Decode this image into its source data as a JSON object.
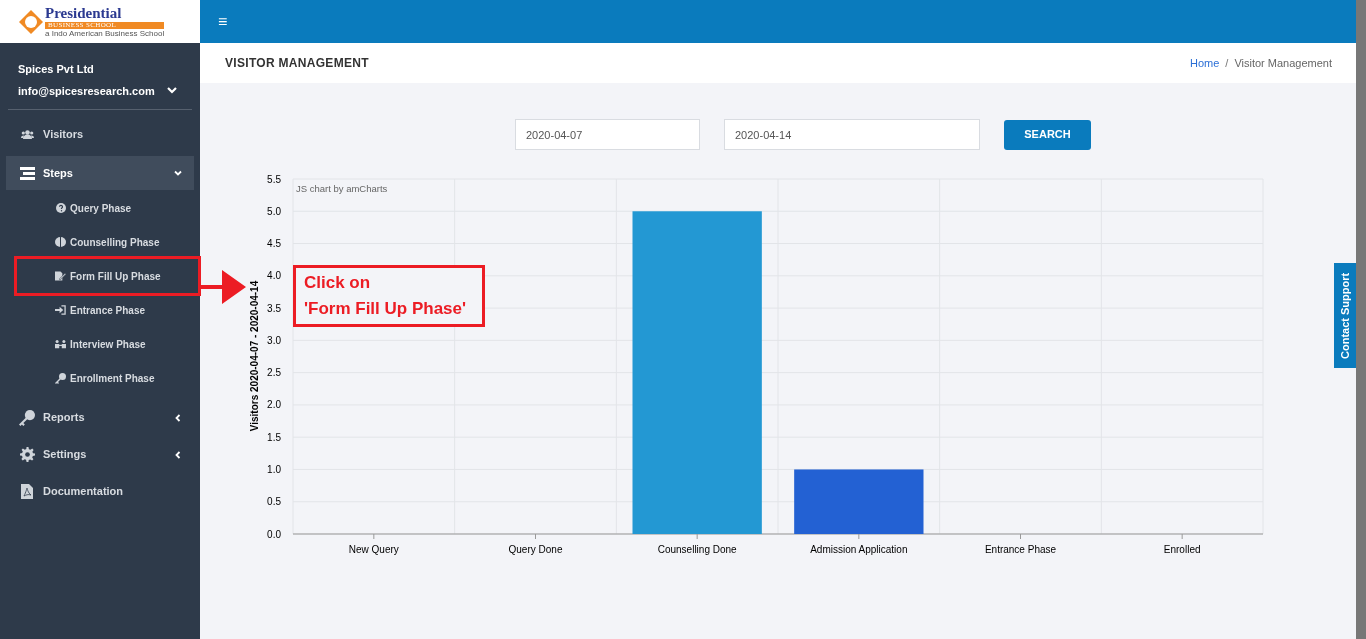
{
  "logo": {
    "name": "Presidential",
    "subtitle": "BUSINESS SCHOOL",
    "tagline": "a Indo American Business School"
  },
  "user": {
    "name": "Spices Pvt Ltd",
    "email": "info@spicesresearch.com"
  },
  "sidebar": {
    "items": [
      {
        "label": "Visitors",
        "selected": false
      },
      {
        "label": "Steps",
        "selected": true,
        "expanded": true,
        "children": [
          {
            "label": "Query Phase",
            "selected": false
          },
          {
            "label": "Counselling Phase",
            "selected": false
          },
          {
            "label": "Form Fill Up Phase",
            "selected": false
          },
          {
            "label": "Entrance Phase",
            "selected": false
          },
          {
            "label": "Interview Phase",
            "selected": false
          },
          {
            "label": "Enrollment Phase",
            "selected": false
          }
        ]
      },
      {
        "label": "Reports",
        "selected": false,
        "expanded": false
      },
      {
        "label": "Settings",
        "selected": false,
        "expanded": false
      },
      {
        "label": "Documentation",
        "selected": false
      }
    ]
  },
  "topbar": {
    "menu_icon": "≡"
  },
  "page": {
    "title": "VISITOR MANAGEMENT",
    "breadcrumb": [
      "Home",
      "Visitor Management"
    ],
    "breadcrumb_separator": "/"
  },
  "filters": {
    "from": "2020-04-07",
    "to": "2020-04-14",
    "button": "SEARCH"
  },
  "chart": {
    "credit": "JS chart by amCharts",
    "chart_data": {
      "type": "bar",
      "ylabel": "Visitors 2020-04-07 - 2020-04-14",
      "categories": [
        "New Query",
        "Query Done",
        "Counselling Done",
        "Admission Application",
        "Entrance Phase",
        "Enrolled"
      ],
      "values": [
        0,
        0,
        5,
        1,
        0,
        0
      ],
      "colors": [
        "#2398d3",
        "#2398d3",
        "#2398d3",
        "#2361d3",
        "#2398d3",
        "#2398d3"
      ],
      "grid": true,
      "ylim": [
        0,
        5.5
      ],
      "yticks": [
        {
          "value": 0,
          "label": "0.0"
        },
        {
          "value": 0.5,
          "label": "0.5"
        },
        {
          "value": 1,
          "label": "1.0"
        },
        {
          "value": 1.5,
          "label": "1.5"
        },
        {
          "value": 2,
          "label": "2.0"
        },
        {
          "value": 2.5,
          "label": "2.5"
        },
        {
          "value": 3,
          "label": "3.0"
        },
        {
          "value": 3.5,
          "label": "3.5"
        },
        {
          "value": 4,
          "label": "4.0"
        },
        {
          "value": 4.5,
          "label": "4.5"
        },
        {
          "value": 5,
          "label": "5.0"
        },
        {
          "value": 5.5,
          "label": "5.5"
        }
      ]
    }
  },
  "annotation": {
    "lines": [
      "Click on",
      "'Form Fill Up Phase'"
    ]
  },
  "contact_support": "Contact Support"
}
